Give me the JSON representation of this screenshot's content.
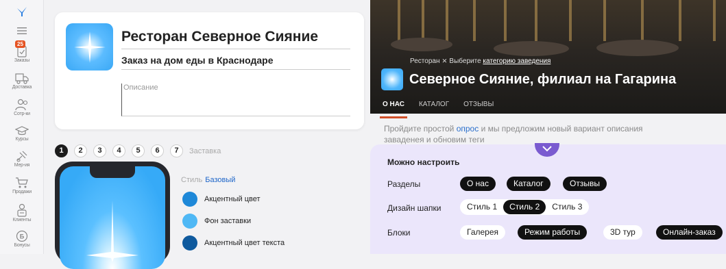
{
  "sidebar": {
    "items": [
      {
        "label": "",
        "icon": "logo-icon"
      },
      {
        "label": "",
        "icon": "menu-icon"
      },
      {
        "label": "Заказы",
        "icon": "orders-icon",
        "badge": "25"
      },
      {
        "label": "Доставка",
        "icon": "delivery-icon"
      },
      {
        "label": "Сотр-ки",
        "icon": "staff-icon"
      },
      {
        "label": "Курсы",
        "icon": "courses-icon"
      },
      {
        "label": "Мер-ия",
        "icon": "events-icon"
      },
      {
        "label": "Продажи",
        "icon": "sales-icon"
      },
      {
        "label": "Клиенты",
        "icon": "clients-icon"
      },
      {
        "label": "Бонусы",
        "icon": "bonus-icon"
      }
    ]
  },
  "editor": {
    "title": "Ресторан Северное Сияние",
    "subtitle": "Заказ на дом еды в Краснодаре",
    "description_placeholder": "Описание"
  },
  "steps": {
    "items": [
      "1",
      "2",
      "3",
      "4",
      "5",
      "6",
      "7"
    ],
    "active": "1",
    "label": "Заставка"
  },
  "style": {
    "label": "Стиль",
    "value": "Базовый",
    "colors": [
      {
        "label": "Акцентный цвет",
        "color": "#1e88d8"
      },
      {
        "label": "Фон заставки",
        "color": "#4fb8f5"
      },
      {
        "label": "Акцентный цвет текста",
        "color": "#0f5a9e"
      }
    ]
  },
  "preview": {
    "breadcrumb_prefix": "Ресторан",
    "breadcrumb_sep": "⨯",
    "breadcrumb_hint": "Выберите",
    "breadcrumb_link": "категорию заведения",
    "title": "Северное Сияние, филиал на Гагарина",
    "tabs": [
      "О НАС",
      "КАТАЛОГ",
      "ОТЗЫВЫ"
    ],
    "active_tab": "О НАС",
    "hint_before": "Пройдите простой",
    "hint_link": "опрос",
    "hint_after": "и мы предложим новый вариант описания заваденея и обновим теги"
  },
  "settings": {
    "title": "Можно настроить",
    "sections_label": "Разделы",
    "sections": [
      "О нас",
      "Каталог",
      "Отзывы"
    ],
    "header_label": "Дизайн шапки",
    "header_styles": [
      "Стиль 1",
      "Стиль 2",
      "Стиль 3"
    ],
    "header_selected": "Стиль 2",
    "blocks_label": "Блоки",
    "blocks": [
      {
        "label": "Галерея",
        "on": false
      },
      {
        "label": "Режим работы",
        "on": true
      },
      {
        "label": "3D тур",
        "on": false
      },
      {
        "label": "Онлайн-заказ",
        "on": true
      }
    ],
    "accent": "#7a5bd0"
  }
}
